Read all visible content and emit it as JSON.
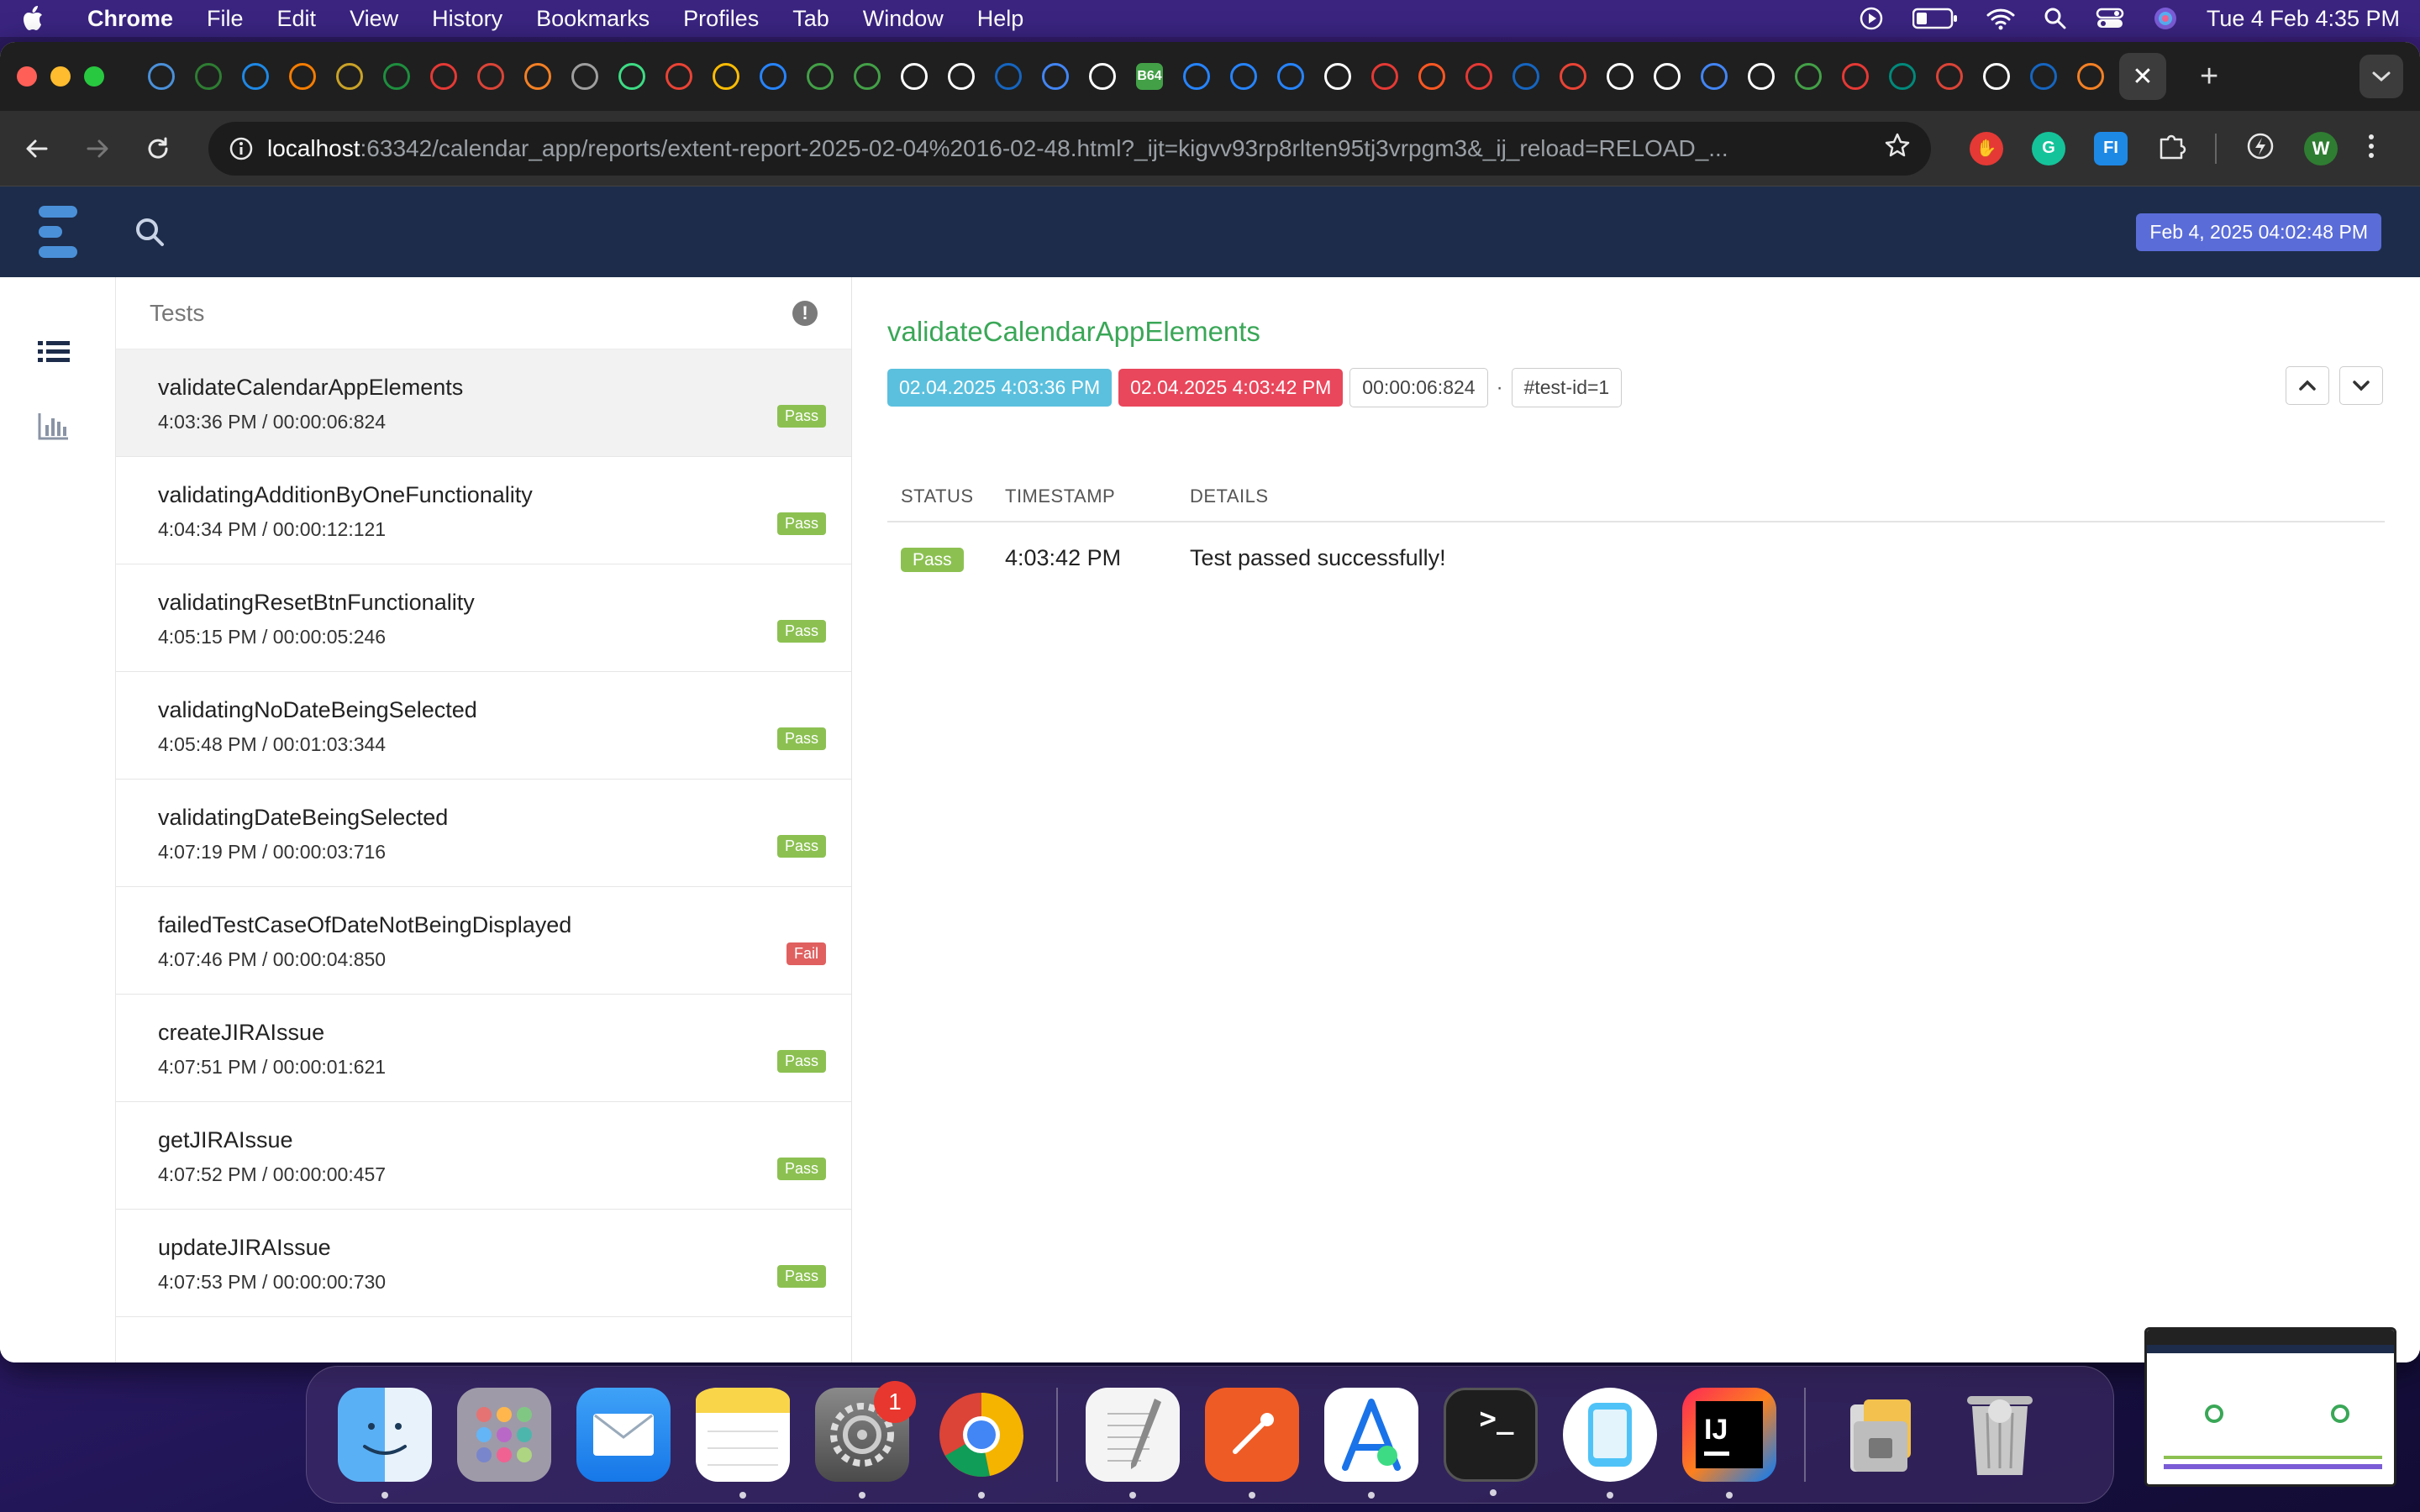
{
  "menubar": {
    "app_name": "Chrome",
    "items": [
      "File",
      "Edit",
      "View",
      "History",
      "Bookmarks",
      "Profiles",
      "Tab",
      "Window",
      "Help"
    ],
    "datetime": "Tue 4 Feb  4:35 PM"
  },
  "browser": {
    "new_tab_glyph": "+",
    "close_tab_glyph": "✕",
    "url_host": "localhost",
    "url_path": ":63342/calendar_app/reports/extent-report-2025-02-04%2016-02-48.html?_ijt=kigvv93rp8rlten95tj3vrpgm3&_ij_reload=RELOAD_...",
    "profile_initial": "W",
    "extension_labels": [
      "FI"
    ],
    "tab_favicon_labels": [
      "B64"
    ],
    "tab_favicons": [
      {
        "icon": "circle-app-icon",
        "color": "#4a90d9"
      },
      {
        "icon": "g-icon",
        "color": "#2e7d32"
      },
      {
        "icon": "circle-app-icon",
        "color": "#1e88e5"
      },
      {
        "icon": "ring-icon",
        "color": "#f57c00"
      },
      {
        "icon": "doge-icon",
        "color": "#c9a227"
      },
      {
        "icon": "plus-sheet-icon",
        "color": "#1e8e3e"
      },
      {
        "icon": "youtube-icon",
        "color": "#e53935"
      },
      {
        "icon": "chrome-icon",
        "color": "#db4437"
      },
      {
        "icon": "stackoverflow-icon",
        "color": "#f48024"
      },
      {
        "icon": "globe-icon",
        "color": "#9e9e9e"
      },
      {
        "icon": "android-icon",
        "color": "#3ddc84"
      },
      {
        "icon": "gmail-icon",
        "color": "#ea4335"
      },
      {
        "icon": "drive-icon",
        "color": "#fbbc04"
      },
      {
        "icon": "atlassian-icon",
        "color": "#2684ff"
      },
      {
        "icon": "mask-icon",
        "color": "#43a047"
      },
      {
        "icon": "mask-icon",
        "color": "#43a047"
      },
      {
        "icon": "github-icon",
        "color": "#ffffff"
      },
      {
        "icon": "openai-icon",
        "color": "#ffffff"
      },
      {
        "icon": "grid-icon",
        "color": "#1565c0"
      },
      {
        "icon": "google-icon",
        "color": "#4285f4"
      },
      {
        "icon": "chrome-icon",
        "color": "#ffffff"
      },
      {
        "icon": "b64-icon",
        "color": "#43a047"
      },
      {
        "icon": "jira-icon",
        "color": "#2684ff"
      },
      {
        "icon": "atlassian-icon",
        "color": "#2684ff"
      },
      {
        "icon": "atlassian-icon",
        "color": "#2684ff"
      },
      {
        "icon": "openai-icon",
        "color": "#ffffff"
      },
      {
        "icon": "opera-icon",
        "color": "#e53935"
      },
      {
        "icon": "rocket-icon",
        "color": "#ff5722"
      },
      {
        "icon": "youtube-icon",
        "color": "#e53935"
      },
      {
        "icon": "grid-icon",
        "color": "#1565c0"
      },
      {
        "icon": "gmail-icon",
        "color": "#ea4335"
      },
      {
        "icon": "github-icon",
        "color": "#ffffff"
      },
      {
        "icon": "download-icon",
        "color": "#ffffff"
      },
      {
        "icon": "google-icon",
        "color": "#4285f4"
      },
      {
        "icon": "chrome-icon",
        "color": "#ffffff"
      },
      {
        "icon": "cube-icon",
        "color": "#43a047"
      },
      {
        "icon": "n-icon",
        "color": "#e53935"
      },
      {
        "icon": "meet-icon",
        "color": "#00897b"
      },
      {
        "icon": "chrome-icon",
        "color": "#db4437"
      },
      {
        "icon": "github-icon",
        "color": "#ffffff"
      },
      {
        "icon": "grid-icon",
        "color": "#1565c0"
      },
      {
        "icon": "stackoverflow-icon",
        "color": "#f48024"
      }
    ]
  },
  "report": {
    "header_date": "Feb 4, 2025 04:02:48 PM",
    "list_title": "Tests",
    "tests": [
      {
        "name": "validateCalendarAppElements",
        "meta": "4:03:36 PM / 00:00:06:824",
        "status": "Pass"
      },
      {
        "name": "validatingAdditionByOneFunctionality",
        "meta": "4:04:34 PM / 00:00:12:121",
        "status": "Pass"
      },
      {
        "name": "validatingResetBtnFunctionality",
        "meta": "4:05:15 PM / 00:00:05:246",
        "status": "Pass"
      },
      {
        "name": "validatingNoDateBeingSelected",
        "meta": "4:05:48 PM / 00:01:03:344",
        "status": "Pass"
      },
      {
        "name": "validatingDateBeingSelected",
        "meta": "4:07:19 PM / 00:00:03:716",
        "status": "Pass"
      },
      {
        "name": "failedTestCaseOfDateNotBeingDisplayed",
        "meta": "4:07:46 PM / 00:00:04:850",
        "status": "Fail"
      },
      {
        "name": "createJIRAIssue",
        "meta": "4:07:51 PM / 00:00:01:621",
        "status": "Pass"
      },
      {
        "name": "getJIRAIssue",
        "meta": "4:07:52 PM / 00:00:00:457",
        "status": "Pass"
      },
      {
        "name": "updateJIRAIssue",
        "meta": "4:07:53 PM / 00:00:00:730",
        "status": "Pass"
      }
    ],
    "detail": {
      "title": "validateCalendarAppElements",
      "start": "02.04.2025 4:03:36 PM",
      "end": "02.04.2025 4:03:42 PM",
      "duration": "00:00:06:824",
      "separator": "·",
      "test_id": "#test-id=1",
      "columns": {
        "status": "STATUS",
        "timestamp": "TIMESTAMP",
        "details": "DETAILS"
      },
      "logs": [
        {
          "status": "Pass",
          "timestamp": "4:03:42 PM",
          "details": "Test passed successfully!"
        }
      ]
    }
  },
  "dock": {
    "badge_count": "1",
    "terminal_glyph": ">_",
    "intellij_label": "IJ"
  }
}
